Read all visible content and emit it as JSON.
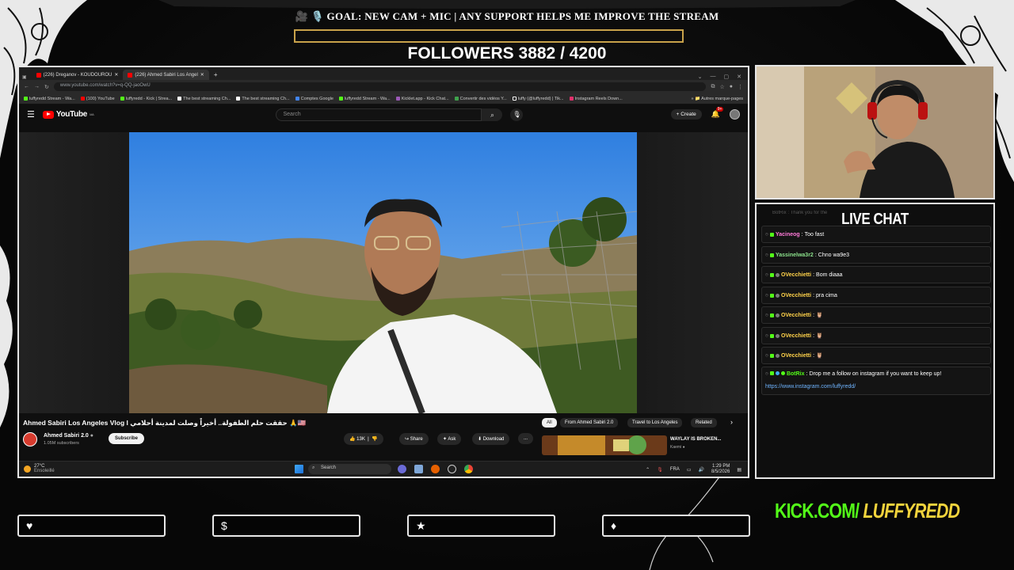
{
  "overlay": {
    "goal_text": "🎥 🎙️ GOAL: NEW CAM + MIC | ANY SUPPORT HELPS ME IMPROVE THE STREAM",
    "goal_progress": 0.0,
    "followers_text": "FOLLOWERS 3882 / 4200",
    "followers_current": 3882,
    "followers_goal": 4200,
    "kick_link_prefix": "KICK.COM/ ",
    "kick_link_handle": "LUFFYREDD",
    "bottom_icons": [
      "heart-icon",
      "dollar-icon",
      "star-icon",
      "drop-icon"
    ],
    "bottom_glyphs": [
      "♥",
      "$",
      "★",
      "♦"
    ]
  },
  "browser": {
    "tabs": [
      {
        "label": "(226) Dreganov - KOUDOUROU",
        "active": false
      },
      {
        "label": "(226) Ahmed Sabiri Los Angel",
        "active": true
      }
    ],
    "new_tab": "+",
    "url": "www.youtube.com/watch?v=q-QQ-jaoOwU",
    "bookmarks": [
      "luffyredd Stream - Wa...",
      "(100) YouTube",
      "luffyredd - Kick | Strea...",
      "The best streaming Ch...",
      "The best streaming Ch...",
      "Comptes Google",
      "luffyredd Stream - Wa...",
      "Kicklet.app - Kick Chat...",
      "Convertir des vidéos Y...",
      "luffy (@luffyredd) | Tik...",
      "Instagram Reels Down..."
    ],
    "bookmarks_folder": "Autres marque-pages"
  },
  "youtube": {
    "logo": "YouTube",
    "logo_region": "MA",
    "search_placeholder": "Search",
    "create_label": "+ Create",
    "notification_count": "9+",
    "video_title": "Ahmed Sabiri Los Angeles Vlog l حققت حلم الطفولة.. أخيراً وصلت لمدينة أحلامي 🙏🇺🇸",
    "channel_name": "Ahmed Sabiri 2.0",
    "channel_subs": "1.05M subscribers",
    "subscribe_label": "Subscribe",
    "like_count": "13K",
    "share_label": "Share",
    "ask_label": "Ask",
    "download_label": "Download",
    "more_label": "...",
    "chips": [
      {
        "label": "All",
        "active": true
      },
      {
        "label": "From Ahmed Sabiri 2.0",
        "active": false
      },
      {
        "label": "Travel to Los Angeles",
        "active": false
      },
      {
        "label": "Related",
        "active": false
      }
    ],
    "rec_title": "WAYLAY IS BROKEN...",
    "rec_channel": "Kaemi"
  },
  "taskbar": {
    "weather_temp": "27°C",
    "weather_desc": "Ensoleillé",
    "search_placeholder": "Search",
    "language": "FRA",
    "time": "1:29 PM",
    "date": "8/5/2026"
  },
  "chat": {
    "title": "LIVE CHAT",
    "ghost_message": "BotRix : Thank you for the",
    "messages": [
      {
        "user": "Yacineog",
        "text": "Too fast",
        "color": "#ff7ad9"
      },
      {
        "user": "Yassinelwa3r2",
        "text": "Chno wa9e3",
        "color": "#8be08b"
      },
      {
        "user": "OVecchietti",
        "text": "Bom diaaa",
        "color": "#ffd24a"
      },
      {
        "user": "OVecchietti",
        "text": "pra cima",
        "color": "#ffd24a"
      },
      {
        "user": "OVecchietti",
        "text": "🦉",
        "color": "#ffd24a"
      },
      {
        "user": "OVecchietti",
        "text": "🦉",
        "color": "#ffd24a"
      },
      {
        "user": "OVecchietti",
        "text": "🦉",
        "color": "#ffd24a"
      }
    ],
    "last_message": {
      "user": "BotRix",
      "text": "Drop me a follow on instagram if you want to keep up!",
      "link": "https://www.instagram.com/luffyredd/",
      "color": "#53fc18"
    }
  }
}
